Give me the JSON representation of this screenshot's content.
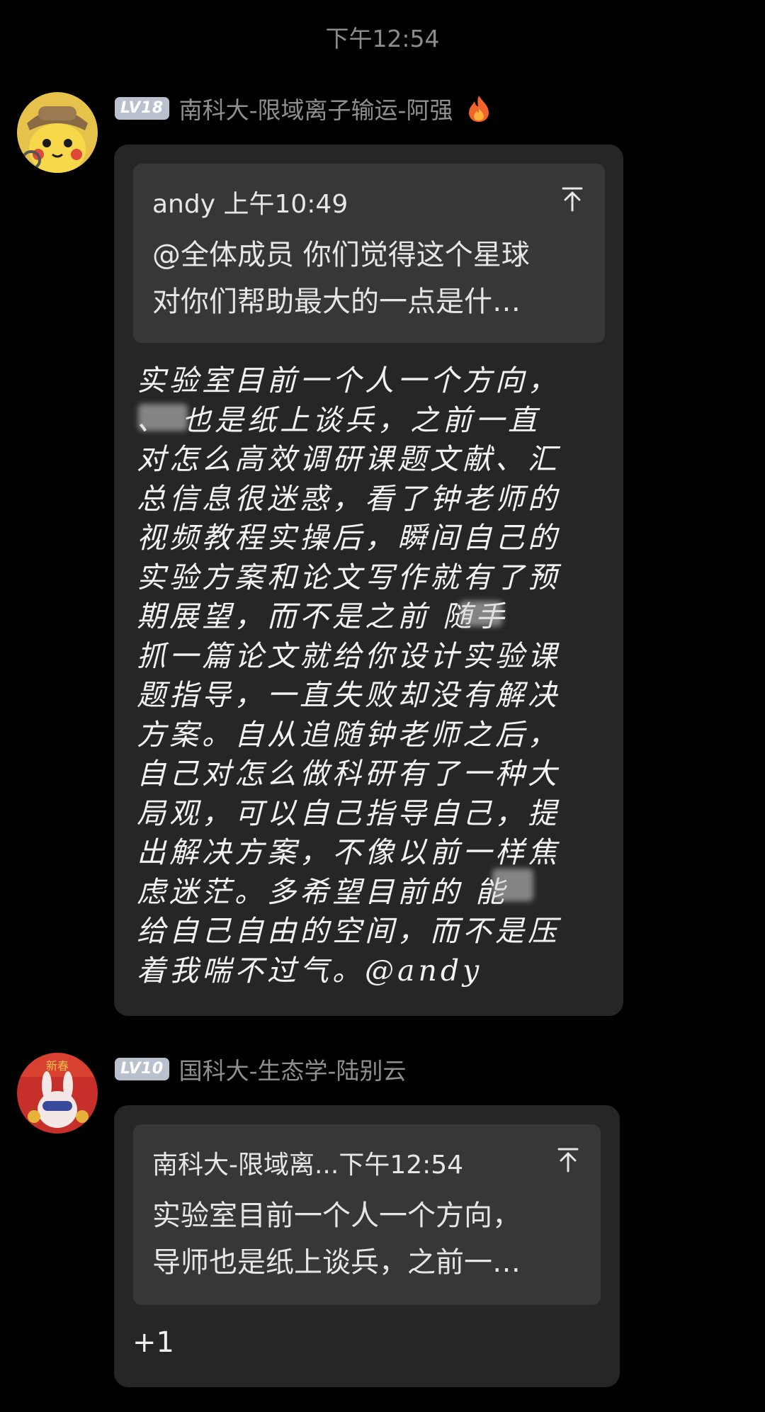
{
  "time_divider": "下午12:54",
  "messages": [
    {
      "level": "LV18",
      "sender": "南科大-限域离子输运-阿强",
      "quote": {
        "header": "andy 上午10:49",
        "text": "@全体成员 你们觉得这个星球\n对你们帮助最大的一点是什…"
      },
      "body": "实验室目前一个人一个方向，\n、 也是纸上谈兵，之前一直\n对怎么高效调研课题文献、汇\n总信息很迷惑，看了钟老师的\n视频教程实操后，瞬间自己的\n实验方案和论文写作就有了预\n期展望，而不是之前 随手\n抓一篇论文就给你设计实验课\n题指导，一直失败却没有解决\n方案。自从追随钟老师之后，\n自己对怎么做科研有了一种大\n局观，可以自己指导自己，提\n出解决方案，不像以前一样焦\n虑迷茫。多希望目前的 能\n给自己自由的空间，而不是压\n着我喘不过气。@andy"
    },
    {
      "level": "LV10",
      "sender": "国科大-生态学-陆别云",
      "quote": {
        "header": "南科大-限域离...下午12:54",
        "text": "实验室目前一个人一个方向，\n导师也是纸上谈兵，之前一…"
      },
      "body": "+1"
    }
  ],
  "icons": {
    "avatar1": "detective-pikachu-avatar",
    "avatar2": "new-year-rabbit-avatar",
    "fire": "fire-icon",
    "pin": "pin-to-top-icon"
  },
  "colors": {
    "background": "#000000",
    "bubble": "#262626",
    "quote": "#373737",
    "badge": "#b9c0ce",
    "sender": "#8f8f8f"
  }
}
